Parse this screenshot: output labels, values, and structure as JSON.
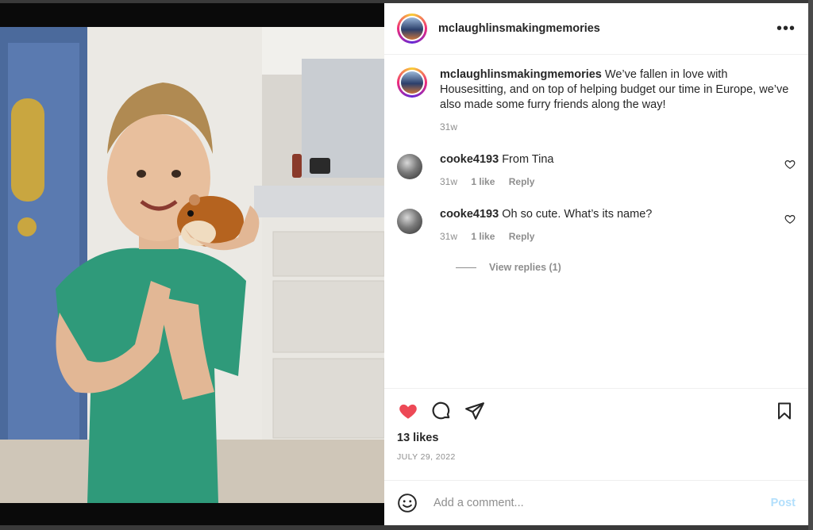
{
  "post": {
    "author": "mclaughlinsmakingmemories",
    "caption": "We’ve fallen in love with Housesitting, and on top of helping budget our time in Europe, we’ve also made some furry friends along the way!",
    "caption_age": "31w"
  },
  "comments": [
    {
      "user": "cooke4193",
      "text": "From Tina",
      "age": "31w",
      "likes": "1 like",
      "reply": "Reply"
    },
    {
      "user": "cooke4193",
      "text": "Oh so cute. What’s its name?",
      "age": "31w",
      "likes": "1 like",
      "reply": "Reply"
    }
  ],
  "view_replies": "View replies (1)",
  "likes": "13 likes",
  "date": "JULY 29, 2022",
  "add_comment": {
    "placeholder": "Add a comment...",
    "post_label": "Post"
  },
  "icons": {
    "more": "more-options-icon",
    "like": "heart-filled-icon",
    "comment": "comment-bubble-icon",
    "share": "paper-plane-icon",
    "save": "bookmark-icon",
    "emoji": "emoji-icon"
  },
  "colors": {
    "like_red": "#ed4956",
    "post_blue": "#b2dffc",
    "meta_gray": "#8e8e8e"
  }
}
